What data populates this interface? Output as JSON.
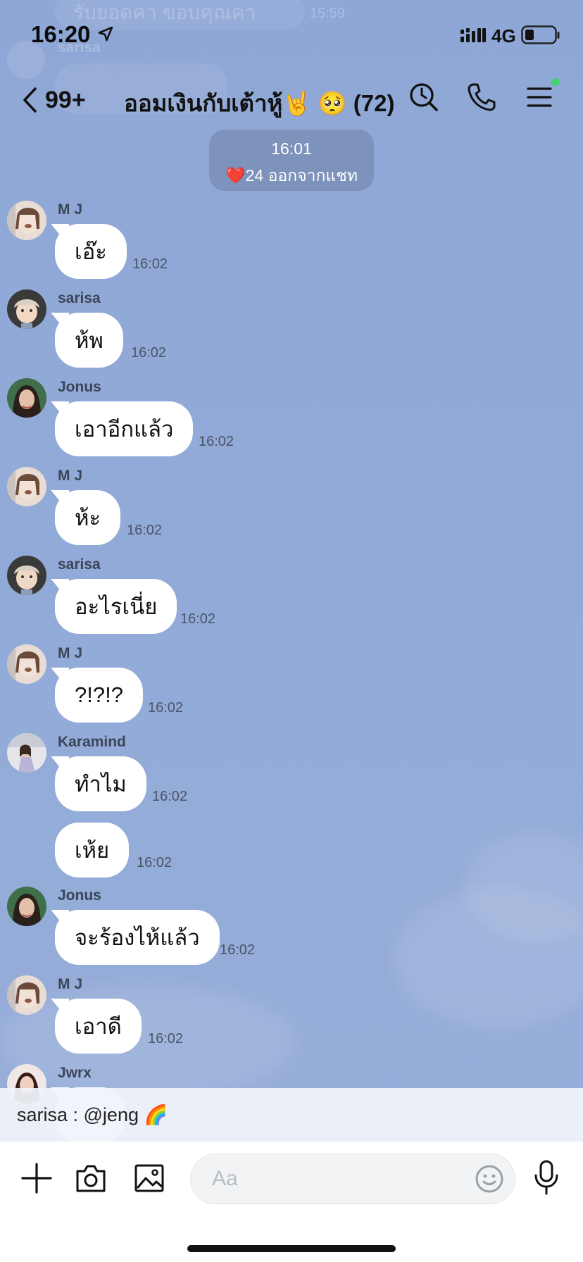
{
  "status_bar": {
    "time": "16:20",
    "network": "4G"
  },
  "header": {
    "back_count": "99+",
    "title": "ออมเงินกับเต้าหู้🤘 🥺 (72)"
  },
  "ghost": {
    "prev_text": "รับยอดคา ขอบคุณคา",
    "prev_time": "15:59",
    "prev_sender": "sarisa"
  },
  "system_notice": {
    "time": "16:01",
    "text": "❤️24 ออกจากแชท"
  },
  "messages": [
    {
      "sender": "M J",
      "text": "เอ๊ะ",
      "time": "16:02"
    },
    {
      "sender": "sarisa",
      "text": "ห้พ",
      "time": "16:02"
    },
    {
      "sender": "Jonus",
      "text": "เอาอีกแล้ว",
      "time": "16:02"
    },
    {
      "sender": "M J",
      "text": "ห้ะ",
      "time": "16:02"
    },
    {
      "sender": "sarisa",
      "text": "อะไรเนี่ย",
      "time": "16:02"
    },
    {
      "sender": "M J",
      "text": "?!?!?",
      "time": "16:02"
    },
    {
      "sender": "Karamind",
      "text": "ทำไม",
      "time": "16:02"
    },
    {
      "sender": "",
      "text": "เห้ย",
      "time": "16:02"
    },
    {
      "sender": "Jonus",
      "text": "จะร้องไห้แล้ว",
      "time": "16:02"
    },
    {
      "sender": "M J",
      "text": "เอาดี",
      "time": "16:02"
    },
    {
      "sender": "Jwrx",
      "text": "",
      "time": ""
    }
  ],
  "mention_bar": {
    "text": "sarisa : @jeng 🌈"
  },
  "input": {
    "placeholder": "Aa",
    "value": ""
  },
  "colors": {
    "background": "#93abd8",
    "online": "#3ed46b",
    "bubble": "#ffffff"
  }
}
